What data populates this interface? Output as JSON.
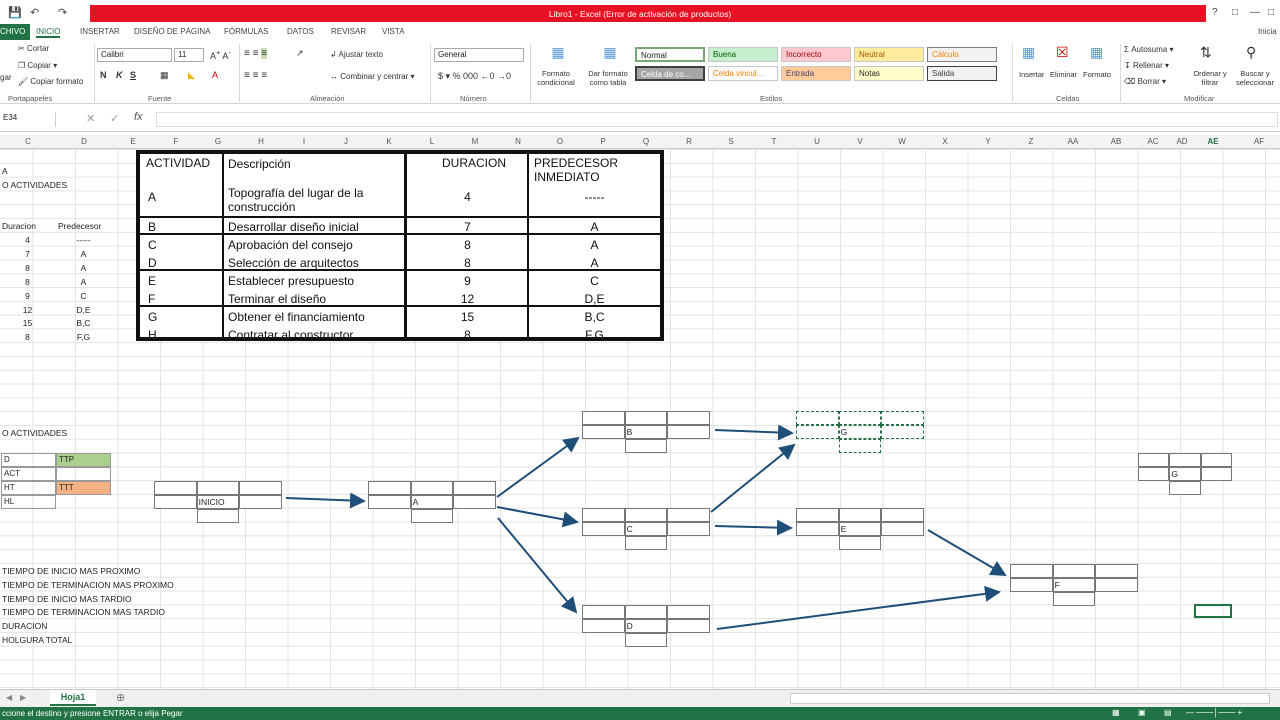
{
  "window": {
    "title": "Libro1 -  Excel (Error de activación de productos)",
    "signin": "Inicia"
  },
  "tabs": [
    "CHIVO",
    "INICIO",
    "INSERTAR",
    "DISEÑO DE PÁGINA",
    "FÓRMULAS",
    "DATOS",
    "REVISAR",
    "VISTA"
  ],
  "ribbon": {
    "clipboard": {
      "cut": "Cortar",
      "copy": "Copiar",
      "format": "Copiar formato",
      "paste": "gar",
      "group": "Portapapeles"
    },
    "font": {
      "name": "Calibri",
      "size": "11",
      "group": "Fuente"
    },
    "align": {
      "wrap": "Ajustar texto",
      "merge": "Combinar y centrar",
      "group": "Alineación"
    },
    "number": {
      "format": "General",
      "group": "Número"
    },
    "styles": {
      "cond": "Formato condicional",
      "table": "Dar formato como tabla",
      "group": "Estilos",
      "normal": "Normal",
      "buena": "Buena",
      "incorrecto": "Incorrecto",
      "neutral": "Neutral",
      "calculo": "Cálculo",
      "celda": "Celda de co...",
      "vinculada": "Celda vincul...",
      "entrada": "Entrada",
      "notas": "Notas",
      "salida": "Salida"
    },
    "cells": {
      "insert": "Insertar",
      "delete": "Eliminar",
      "format": "Formato",
      "group": "Celdas"
    },
    "edit": {
      "autosum": "Autosuma",
      "fill": "Rellenar",
      "clear": "Borrar",
      "sort": "Ordenar y filtrar",
      "find": "Buscar y seleccionar",
      "group": "Modificar"
    }
  },
  "formula_bar": {
    "namebox": "E34",
    "fx": "fx",
    "content": ""
  },
  "columns": [
    "C",
    "D",
    "E",
    "F",
    "G",
    "H",
    "I",
    "J",
    "K",
    "L",
    "M",
    "N",
    "O",
    "P",
    "Q",
    "R",
    "S",
    "T",
    "U",
    "V",
    "W",
    "X",
    "Y",
    "Z",
    "AA",
    "AB",
    "AC",
    "AD",
    "AE",
    "AF"
  ],
  "left_cells": {
    "a": "A",
    "act1": "O ACTIVIDADES",
    "duracion_h": "Duracion",
    "predecesor_h": "Predecesor",
    "dur": [
      "4",
      "7",
      "8",
      "8",
      "9",
      "12",
      "15",
      "8"
    ],
    "pred": [
      "-----",
      "A",
      "A",
      "A",
      "C",
      "D,E",
      "B,C",
      "F,G"
    ],
    "act2": "O ACTIVIDADES",
    "legend": [
      [
        "D",
        "TTP"
      ],
      [
        "ACT",
        ""
      ],
      [
        "HT",
        "TTT"
      ],
      [
        "HL",
        ""
      ]
    ],
    "notes": [
      "TIEMPO DE INICIO MAS  PROXIMO",
      "TIEMPO DE TERMINACION MAS  PROXIMO",
      "TIEMPO DE INICIO MAS  TARDIO",
      "TIEMPO DE  TERMINACION  MAS  TARDIO",
      "DURACION",
      "HOLGURA TOTAL"
    ]
  },
  "activity_table": {
    "headers": {
      "actividad": "ACTIVIDAD",
      "descripcion": "Descripción",
      "duracion": "DURACION",
      "predecesor": "PREDECESOR INMEDIATO"
    },
    "rows": [
      {
        "act": "A",
        "desc": "Topografía del lugar de la construcción",
        "dur": "4",
        "pred": "-----"
      },
      {
        "act": "B",
        "desc": "Desarrollar diseño inicial",
        "dur": "7",
        "pred": "A"
      },
      {
        "act": "C",
        "desc": "Aprobación del consejo",
        "dur": "8",
        "pred": "A"
      },
      {
        "act": "D",
        "desc": "Selección de arquitectos",
        "dur": "8",
        "pred": "A"
      },
      {
        "act": "E",
        "desc": "Establecer presupuesto",
        "dur": "9",
        "pred": "C"
      },
      {
        "act": "F",
        "desc": "Terminar el diseño",
        "dur": "12",
        "pred": "D,E"
      },
      {
        "act": "G",
        "desc": "Obtener el financiamiento",
        "dur": "15",
        "pred": "B,C"
      },
      {
        "act": "H",
        "desc": "Contratar al constructor",
        "dur": "8",
        "pred": "F,G"
      }
    ]
  },
  "network": {
    "nodes": [
      "INICIO",
      "A",
      "B",
      "C",
      "D",
      "G",
      "E",
      "F",
      "G"
    ]
  },
  "sheet": {
    "tab": "Hoja1"
  },
  "status": {
    "text": "ccione el destino y presione ENTRAR o elija Pegar"
  },
  "colors": {
    "excel_green": "#217346",
    "title_red": "#e81123",
    "arrow": "#1f4e79",
    "ttp": "#a9d08e",
    "ttt": "#f4b183"
  }
}
